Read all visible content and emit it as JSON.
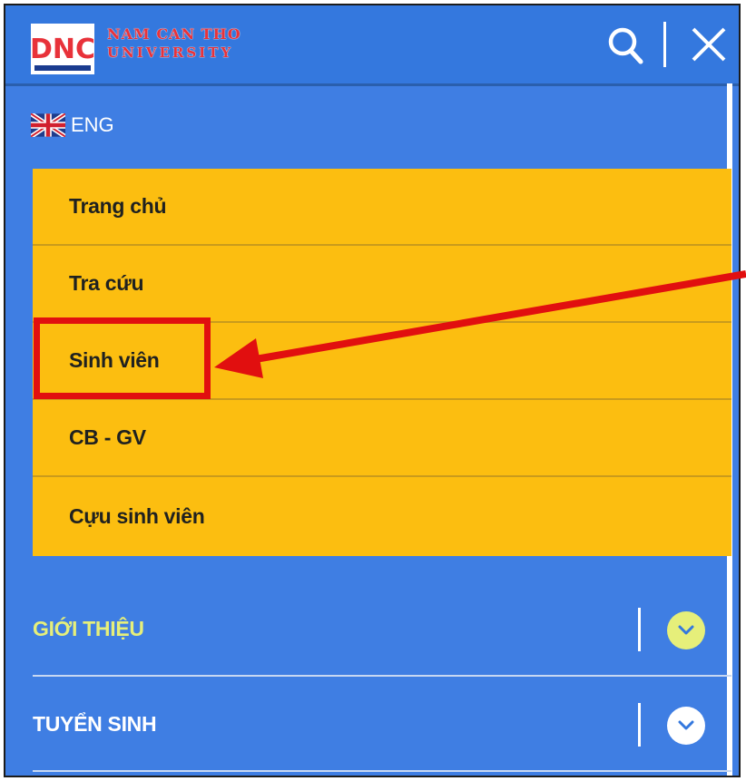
{
  "header": {
    "brand_line1": "NAM CAN THO",
    "brand_line2": "UNIVERSITY",
    "logo_text": "DNC",
    "search_icon": "search-icon",
    "close_icon": "close-icon"
  },
  "language": {
    "label": "ENG",
    "flag_icon": "uk-flag-icon"
  },
  "menu": {
    "items": [
      {
        "label": "Trang chủ"
      },
      {
        "label": "Tra cứu"
      },
      {
        "label": "Sinh viên"
      },
      {
        "label": "CB - GV"
      },
      {
        "label": "Cựu sinh viên"
      }
    ]
  },
  "sections": [
    {
      "label": "GIỚI THIỆU",
      "color": "#e6ef7a",
      "chevron_color": "#e6ef7a",
      "expand_icon": "chevron-down-icon"
    },
    {
      "label": "TUYỂN SINH",
      "color": "#ffffff",
      "chevron_color": "#ffffff",
      "expand_icon": "chevron-down-icon"
    }
  ],
  "colors": {
    "header_bg": "#3478de",
    "panel_bg": "#3f7ee3",
    "menu_bg": "#fcbe10",
    "annotation": "#e10f0f",
    "brand_text": "#e8323a"
  }
}
